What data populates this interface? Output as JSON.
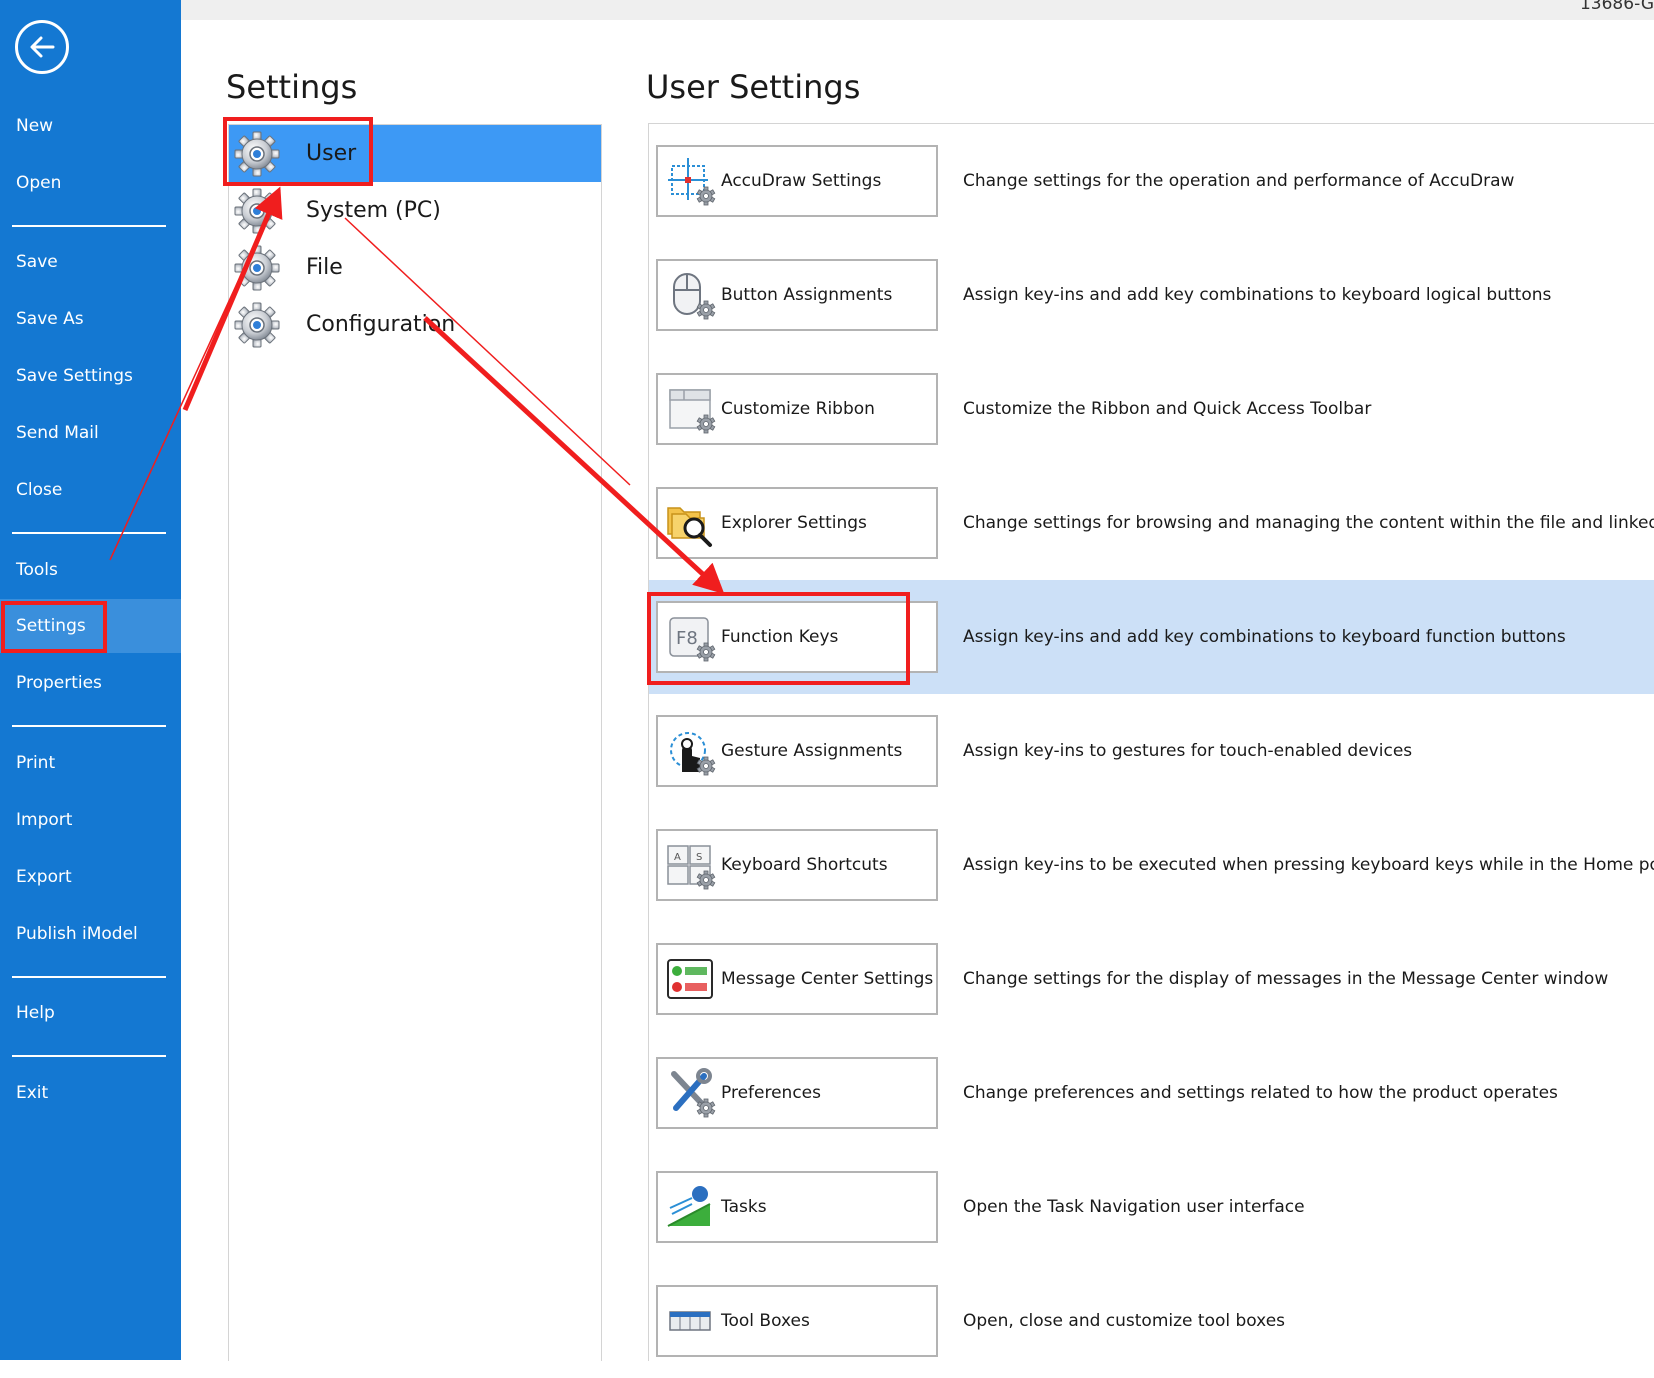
{
  "window": {
    "title_fragment": "13686-G"
  },
  "nav": {
    "items": [
      {
        "label": "New"
      },
      {
        "label": "Open"
      },
      {
        "label": "Save"
      },
      {
        "label": "Save As"
      },
      {
        "label": "Save Settings"
      },
      {
        "label": "Send Mail"
      },
      {
        "label": "Close"
      },
      {
        "label": "Tools"
      },
      {
        "label": "Settings",
        "selected": true
      },
      {
        "label": "Properties"
      },
      {
        "label": "Print"
      },
      {
        "label": "Import"
      },
      {
        "label": "Export"
      },
      {
        "label": "Publish iModel"
      },
      {
        "label": "Help"
      },
      {
        "label": "Exit"
      }
    ]
  },
  "categories": {
    "title": "Settings",
    "items": [
      {
        "label": "User",
        "selected": true,
        "icon": "gear-icon"
      },
      {
        "label": "System (PC)",
        "icon": "gear-icon"
      },
      {
        "label": "File",
        "icon": "gear-icon"
      },
      {
        "label": "Configuration",
        "icon": "gear-icon"
      }
    ]
  },
  "user_settings": {
    "title": "User Settings",
    "items": [
      {
        "label": "AccuDraw Settings",
        "description": "Change settings for the operation and performance of AccuDraw",
        "icon": "accudraw-icon"
      },
      {
        "label": "Button Assignments",
        "description": "Assign key-ins and add key combinations to keyboard logical buttons",
        "icon": "mouse-icon"
      },
      {
        "label": "Customize Ribbon",
        "description": "Customize the Ribbon and Quick Access Toolbar",
        "icon": "ribbon-icon"
      },
      {
        "label": "Explorer Settings",
        "description": "Change settings for browsing and managing the content within the file and linked data",
        "icon": "explorer-icon"
      },
      {
        "label": "Function Keys",
        "description": "Assign key-ins and add key combinations to keyboard function buttons",
        "icon": "function-key-icon",
        "selected": true
      },
      {
        "label": "Gesture Assignments",
        "description": "Assign key-ins to gestures for touch-enabled devices",
        "icon": "gesture-icon"
      },
      {
        "label": "Keyboard Shortcuts",
        "description": "Assign key-ins to be executed when pressing keyboard keys while in the Home position",
        "icon": "keyboard-icon"
      },
      {
        "label": "Message Center Settings",
        "description": "Change settings for the display of messages in the Message Center window",
        "icon": "message-center-icon"
      },
      {
        "label": "Preferences",
        "description": "Change preferences and settings related to how the product operates",
        "icon": "preferences-icon"
      },
      {
        "label": "Tasks",
        "description": "Open the Task Navigation user interface",
        "icon": "tasks-icon"
      },
      {
        "label": "Tool Boxes",
        "description": "Open, close and customize tool boxes",
        "icon": "toolbox-icon"
      }
    ]
  },
  "colors": {
    "nav_bg": "#1478d2",
    "nav_selected": "#3a8fdc",
    "category_selected": "#3d99f5",
    "row_selected": "#cce0f7",
    "annotation": "#f01e1e"
  }
}
